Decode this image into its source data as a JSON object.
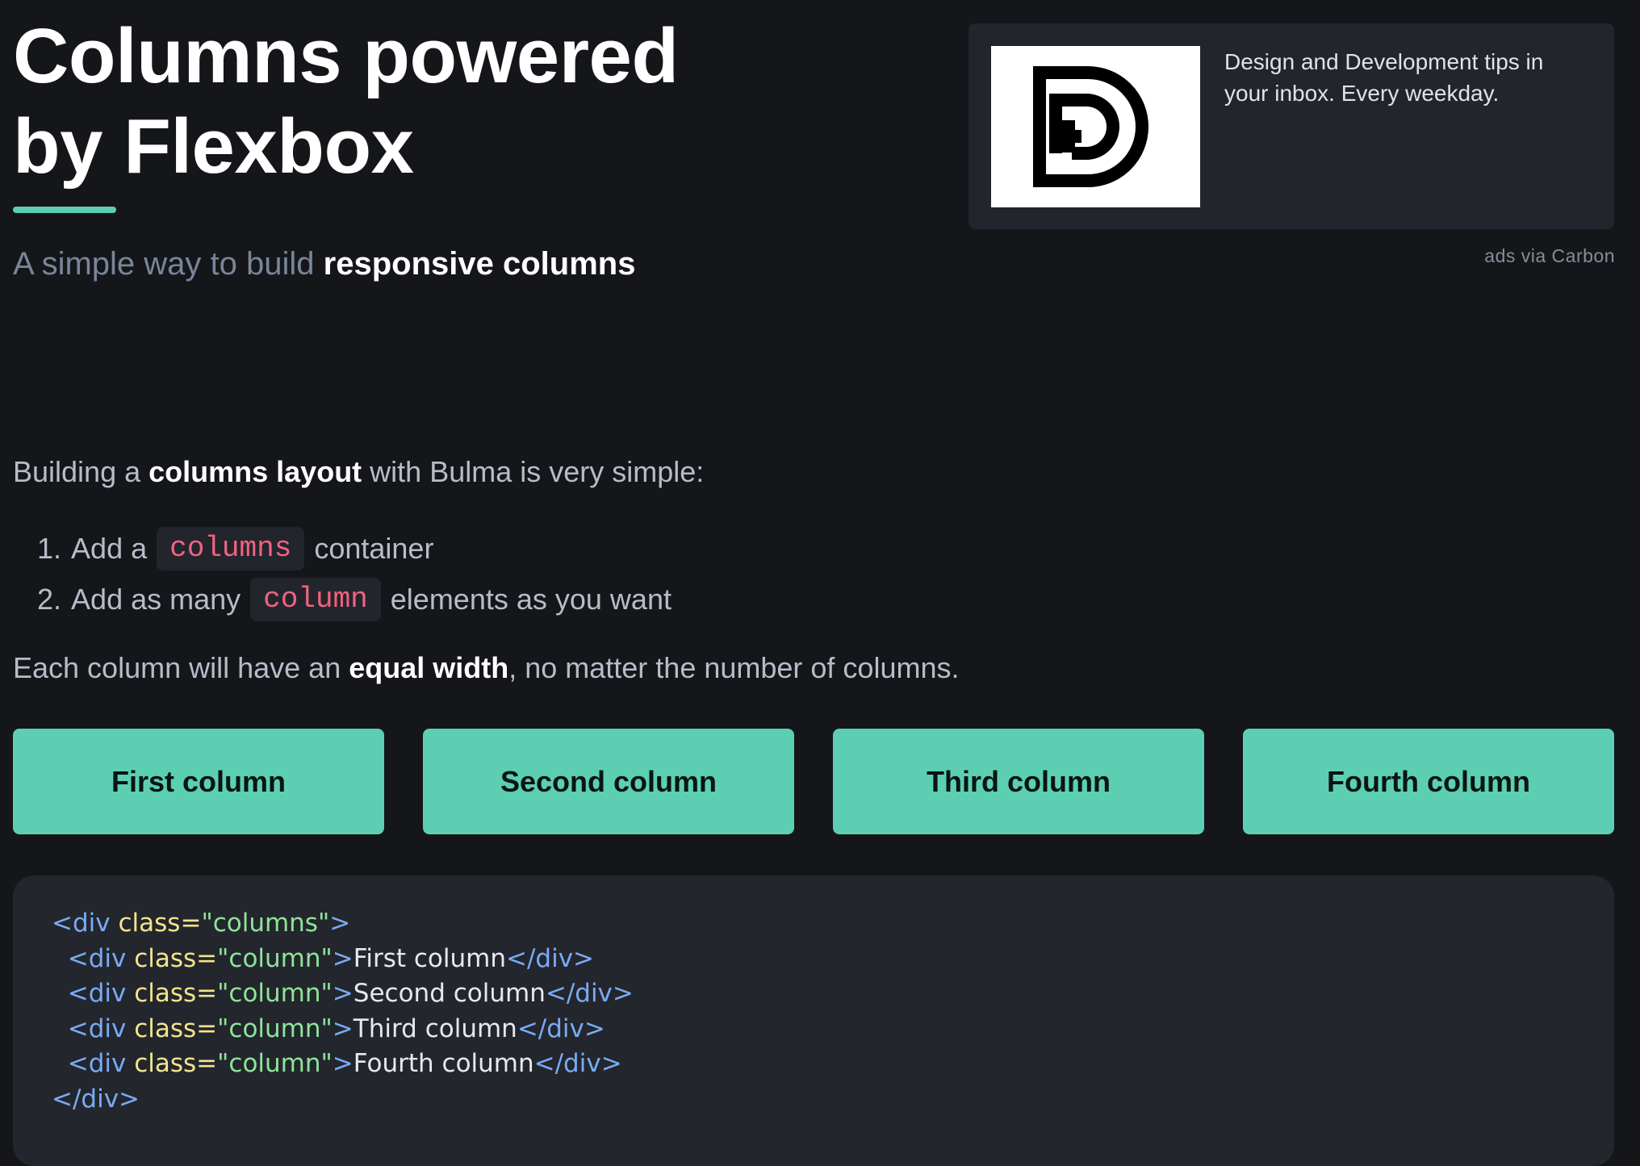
{
  "hero": {
    "title_line1": "Columns powered",
    "title_line2": "by Flexbox",
    "subtitle_pre": "A simple way to build ",
    "subtitle_strong": "responsive columns"
  },
  "ad": {
    "logo_icon": "dd-logo-icon",
    "text": "Design and Development tips in your inbox. Every weekday.",
    "via": "ads via Carbon"
  },
  "content": {
    "intro_pre": "Building a ",
    "intro_strong": "columns layout",
    "intro_post": " with Bulma is very simple:",
    "steps": [
      {
        "num": "1.",
        "pre": "Add a",
        "code": "columns",
        "post": "container"
      },
      {
        "num": "2.",
        "pre": "Add as many",
        "code": "column",
        "post": "elements as you want"
      }
    ],
    "note_pre": "Each column will have an ",
    "note_strong": "equal width",
    "note_post": ", no matter the number of columns."
  },
  "columns": [
    "First column",
    "Second column",
    "Third column",
    "Fourth column"
  ],
  "code": {
    "open_tag": "<div",
    "attr": "class",
    "eq": "=",
    "outer_class": "\"columns\"",
    "inner_class": "\"column\"",
    "gt": ">",
    "close_tag": "</div>",
    "rows": [
      "First column",
      "Second column",
      "Third column",
      "Fourth column"
    ]
  },
  "colors": {
    "background": "#14161a",
    "accent": "#5ccfb3",
    "code_keyword": "#f0637f",
    "code_tag": "#7aaaf5",
    "code_attr": "#f3e48c",
    "code_string": "#8fe39a"
  }
}
